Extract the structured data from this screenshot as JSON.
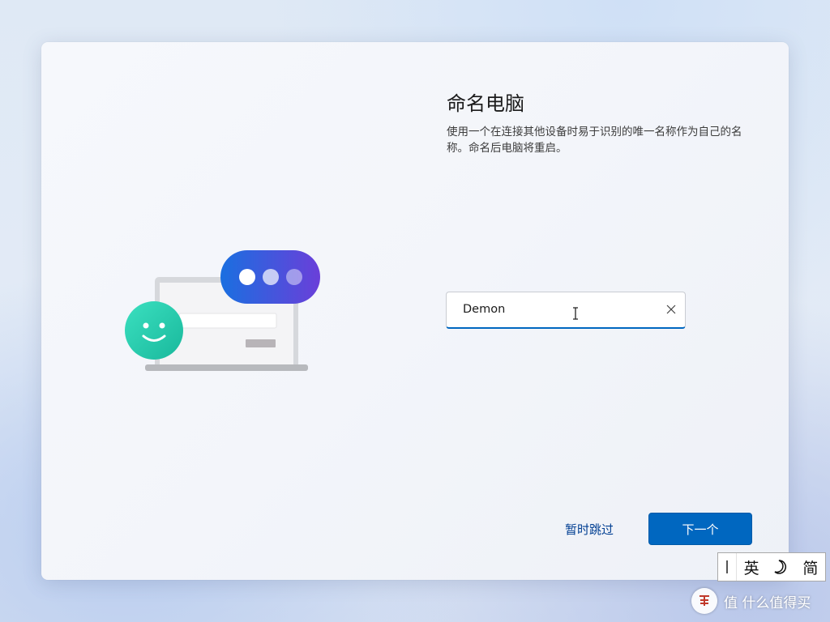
{
  "page": {
    "title": "命名电脑",
    "description": "使用一个在连接其他设备时易于识别的唯一名称作为自己的名称。命名后电脑将重启。"
  },
  "name_field": {
    "value": "Demon",
    "clear_icon": "close-icon"
  },
  "buttons": {
    "skip_label": "暂时跳过",
    "next_label": "下一个"
  },
  "ime_toolbar": {
    "language": "英",
    "mode": "简",
    "icons": [
      "ime-handle-icon",
      "half-width-moon-icon"
    ]
  },
  "watermark": {
    "text": "值 什么值得买"
  },
  "colors": {
    "accent": "#0067c0",
    "skip_text": "#003e92",
    "bubble_blue": "#1a6fe0",
    "bubble_purple": "#6a3fd9",
    "smiley_teal": "#2fd1b5"
  }
}
